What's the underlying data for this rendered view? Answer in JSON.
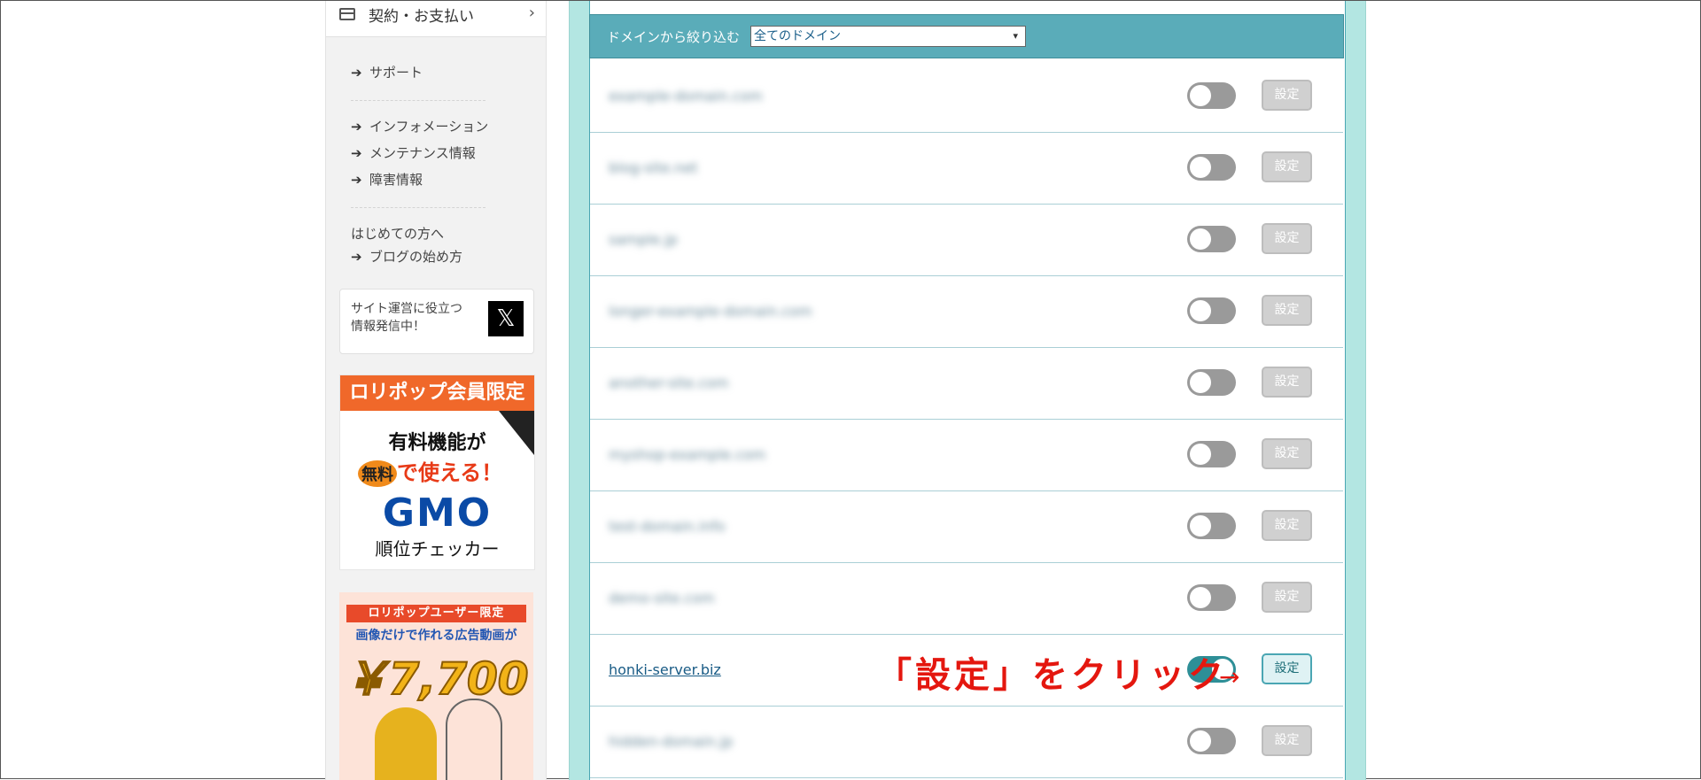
{
  "sidebar": {
    "contract_label": "契約・お支払い",
    "support": "サポート",
    "info_links": [
      "インフォメーション",
      "メンテナンス情報",
      "障害情報"
    ],
    "beginners": "はじめての方へ",
    "blog_start": "ブログの始め方",
    "x_promo_text": "サイト運営に役立つ\n情報発信中！",
    "x_logo": "𝕏",
    "ad1": {
      "band": "ロリポップ会員限定",
      "line1": "有料機能が",
      "badge": "無料",
      "line2": "で使える！",
      "brand": "GMO",
      "product": "順位チェッカー"
    },
    "ad2": {
      "band": "ロリポップユーザー限定",
      "line1": "画像だけで作れる広告動画が",
      "price": "￥7,700"
    }
  },
  "filter": {
    "label": "ドメインから絞り込む",
    "selected": "全てのドメイン"
  },
  "set_label": "設定",
  "domains": [
    {
      "name": "example-domain.com",
      "blurred": true,
      "enabled": false
    },
    {
      "name": "blog-site.net",
      "blurred": true,
      "enabled": false
    },
    {
      "name": "sample.jp",
      "blurred": true,
      "enabled": false
    },
    {
      "name": "longer-example-domain.com",
      "blurred": true,
      "enabled": false
    },
    {
      "name": "another-site.com",
      "blurred": true,
      "enabled": false
    },
    {
      "name": "myshop-example.com",
      "blurred": true,
      "enabled": false
    },
    {
      "name": "test-domain.info",
      "blurred": true,
      "enabled": false
    },
    {
      "name": "demo-site.com",
      "blurred": true,
      "enabled": false
    },
    {
      "name": "honki-server.biz",
      "blurred": false,
      "enabled": true
    },
    {
      "name": "hidden-domain.jp",
      "blurred": true,
      "enabled": false
    }
  ],
  "annotation": "「設定」をクリック",
  "annotation_arrow": "→"
}
